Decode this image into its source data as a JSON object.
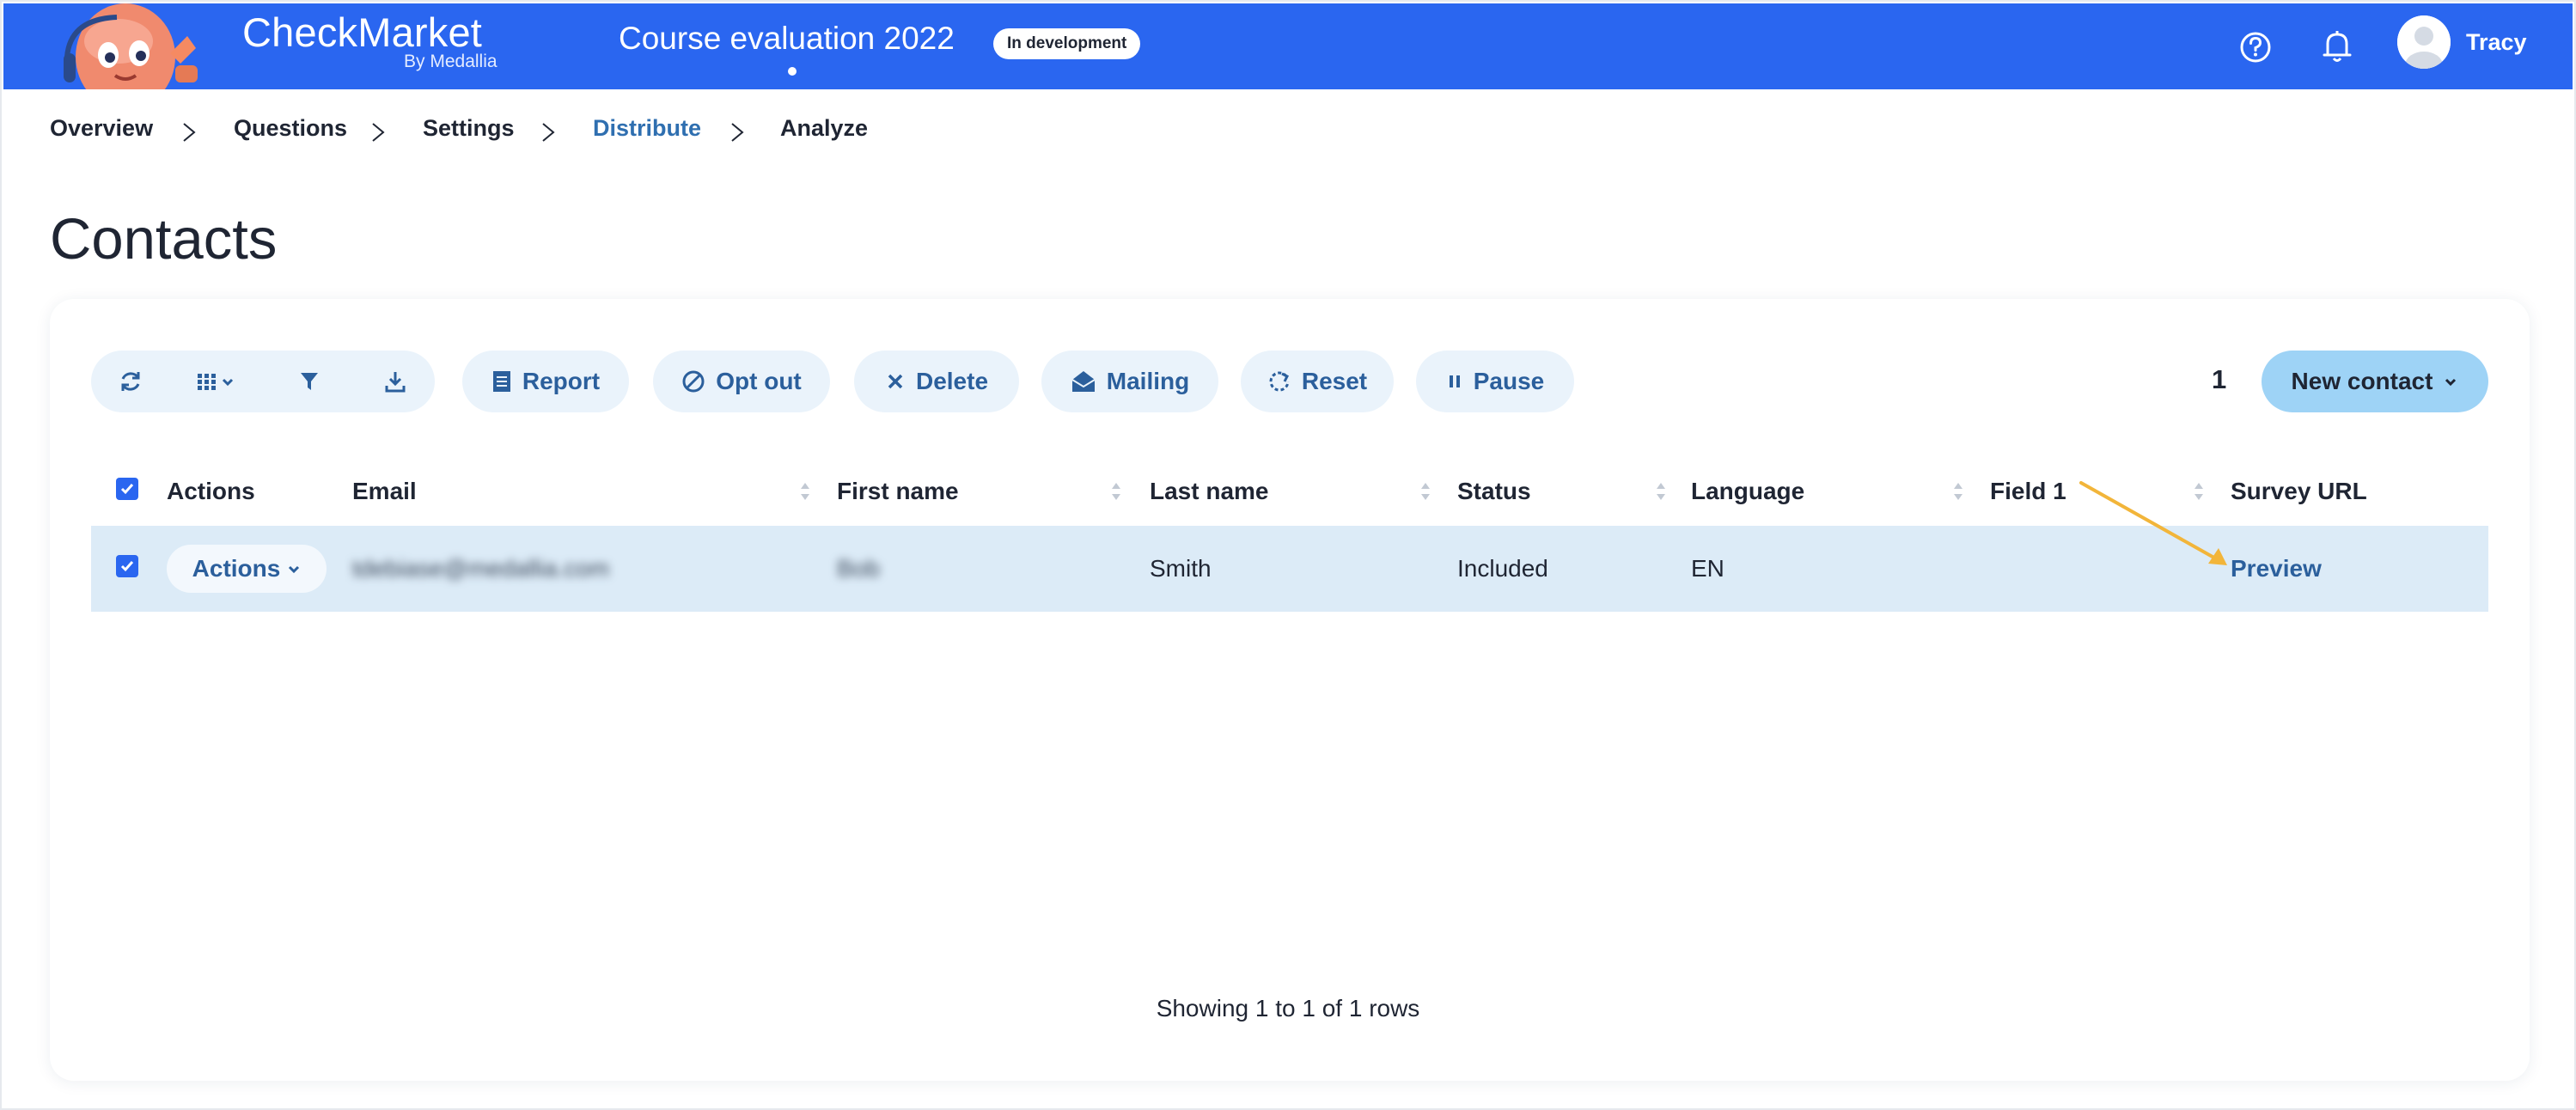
{
  "header": {
    "brand": "CheckMarket",
    "brand_sub": "By Medallia",
    "survey_title": "Course evaluation 2022",
    "status_badge": "In development",
    "user_name": "Tracy",
    "accent_color": "#2a66f0"
  },
  "breadcrumb": [
    {
      "label": "Overview",
      "active": false
    },
    {
      "label": "Questions",
      "active": false
    },
    {
      "label": "Settings",
      "active": false
    },
    {
      "label": "Distribute",
      "active": true
    },
    {
      "label": "Analyze",
      "active": false
    }
  ],
  "page": {
    "title": "Contacts"
  },
  "toolbar": {
    "icons": [
      "refresh-icon",
      "columns-icon",
      "filter-icon",
      "download-icon"
    ],
    "buttons": [
      {
        "label": "Report",
        "icon": "report-icon"
      },
      {
        "label": "Opt out",
        "icon": "block-icon"
      },
      {
        "label": "Delete",
        "icon": "close-icon"
      },
      {
        "label": "Mailing",
        "icon": "envelope-icon"
      },
      {
        "label": "Reset",
        "icon": "reset-icon"
      },
      {
        "label": "Pause",
        "icon": "pause-icon"
      }
    ],
    "selected_count": "1",
    "new_contact_label": "New contact"
  },
  "table": {
    "headers": [
      "Actions",
      "Email",
      "First name",
      "Last name",
      "Status",
      "Language",
      "Field 1",
      "Survey URL"
    ],
    "rows": [
      {
        "actions_label": "Actions",
        "email": "tdebiase@medallia.com",
        "first_name": "Bob",
        "last_name": "Smith",
        "status": "Included",
        "language": "EN",
        "field_1": "",
        "survey_url": "Preview",
        "selected": true
      }
    ],
    "footer": "Showing 1 to 1 of 1 rows"
  },
  "annotation": {
    "arrow_color": "#f2b53a"
  }
}
